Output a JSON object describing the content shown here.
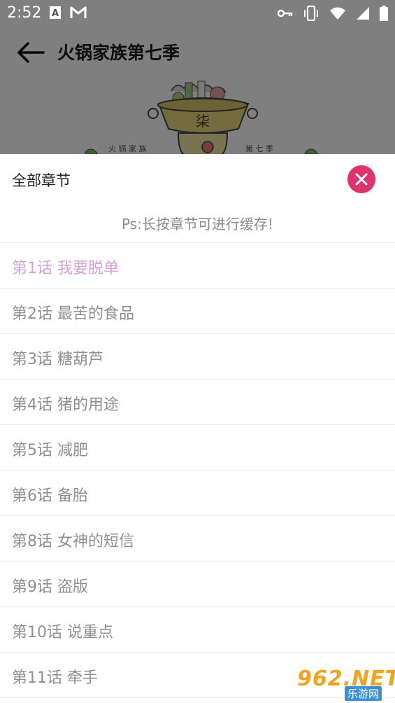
{
  "status_bar": {
    "time": "2:52",
    "left_icons": [
      "font-a-icon",
      "gmail-m-icon"
    ],
    "right_icons": [
      "vpn-key-icon",
      "vibrate-icon",
      "wifi-icon",
      "signal-icon",
      "battery-icon"
    ]
  },
  "appbar": {
    "title": "火锅家族第七季",
    "back_icon": "arrow-back-icon"
  },
  "cover": {
    "left_caption": "火 锅 家 族",
    "right_caption": "第 七 季",
    "pot_mark": "柒"
  },
  "sheet": {
    "title": "全部章节",
    "close_icon": "close-icon",
    "hint": "Ps:长按章节可进行缓存!",
    "chapters": [
      "第1话 我要脱单",
      "第2话 最苦的食品",
      "第3话 糖葫芦",
      "第4话 猪的用途",
      "第5话 减肥",
      "第6话 备胎",
      "第8话 女神的短信",
      "第9话 盗版",
      "第10话 说重点",
      "第11话 牵手"
    ],
    "current_index": 0
  },
  "watermark": {
    "main": "962.NET",
    "sub": "乐游网"
  },
  "colors": {
    "accent_close": "#e0336e",
    "current_chapter": "#d4a4d8",
    "chapter_text": "#8f8f8f",
    "watermark_orange": "#f2a31b",
    "watermark_blue": "#3a91d6"
  }
}
